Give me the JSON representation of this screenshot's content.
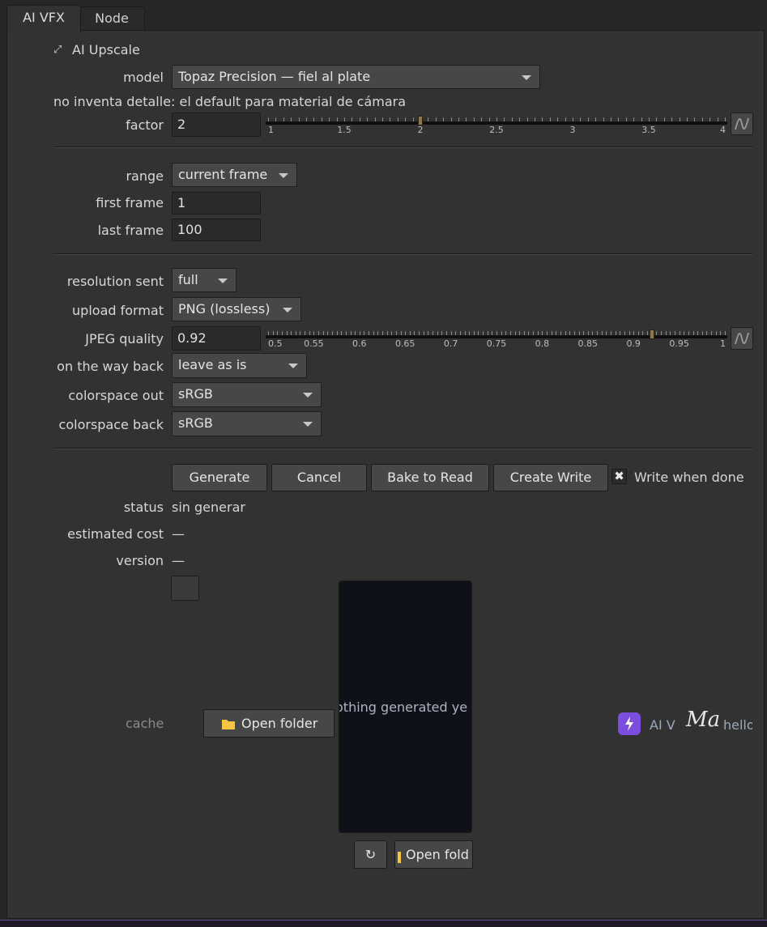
{
  "tabs": [
    {
      "label": "AI VFX"
    },
    {
      "label": "Node"
    }
  ],
  "section": {
    "title": "AI Upscale",
    "collapse_glyph": "⤢"
  },
  "model": {
    "label": "model",
    "value": "Topaz Precision — fiel al plate"
  },
  "model_note": "no inventa detalle: el default para material de cámara",
  "factor": {
    "label": "factor",
    "value": "2",
    "ticks": [
      "1",
      "1.5",
      "2",
      "2.5",
      "3",
      "3.5",
      "4"
    ],
    "min": 1,
    "max": 4,
    "current": 2
  },
  "range": {
    "label": "range",
    "value": "current frame"
  },
  "first_frame": {
    "label": "first frame",
    "value": "1"
  },
  "last_frame": {
    "label": "last frame",
    "value": "100"
  },
  "resolution_sent": {
    "label": "resolution sent",
    "value": "full"
  },
  "upload_format": {
    "label": "upload format",
    "value": "PNG (lossless)"
  },
  "jpeg_quality": {
    "label": "JPEG quality",
    "value": "0.92",
    "ticks": [
      "0.5",
      "0.55",
      "0.6",
      "0.65",
      "0.7",
      "0.75",
      "0.8",
      "0.85",
      "0.9",
      "0.95",
      "1"
    ],
    "min": 0.5,
    "max": 1,
    "current": 0.92
  },
  "on_the_way_back": {
    "label": "on the way back",
    "value": "leave as is"
  },
  "colorspace_out": {
    "label": "colorspace out",
    "value": "sRGB"
  },
  "colorspace_back": {
    "label": "colorspace back",
    "value": "sRGB"
  },
  "buttons": {
    "generate": "Generate",
    "cancel": "Cancel",
    "bake": "Bake to Read",
    "create_write": "Create Write"
  },
  "write_when_done": {
    "label": "Write when done",
    "checked": true
  },
  "status": {
    "label": "status",
    "value": "sin generar"
  },
  "estimated_cost": {
    "label": "estimated cost",
    "value": "—"
  },
  "version": {
    "label": "version",
    "value": "—"
  },
  "cache": {
    "label": "cache",
    "open_folder": "Open folder"
  },
  "preview": {
    "message": "othing generated ye",
    "refresh_glyph": "↻",
    "open_folder": "Open fold"
  },
  "footer": {
    "brand": "AI V",
    "signature": "Ma",
    "greeting": "hello"
  },
  "colors": {
    "accent_purple": "#7b4ee0",
    "panel": "#323232",
    "preview_bg": "#0e1118"
  }
}
